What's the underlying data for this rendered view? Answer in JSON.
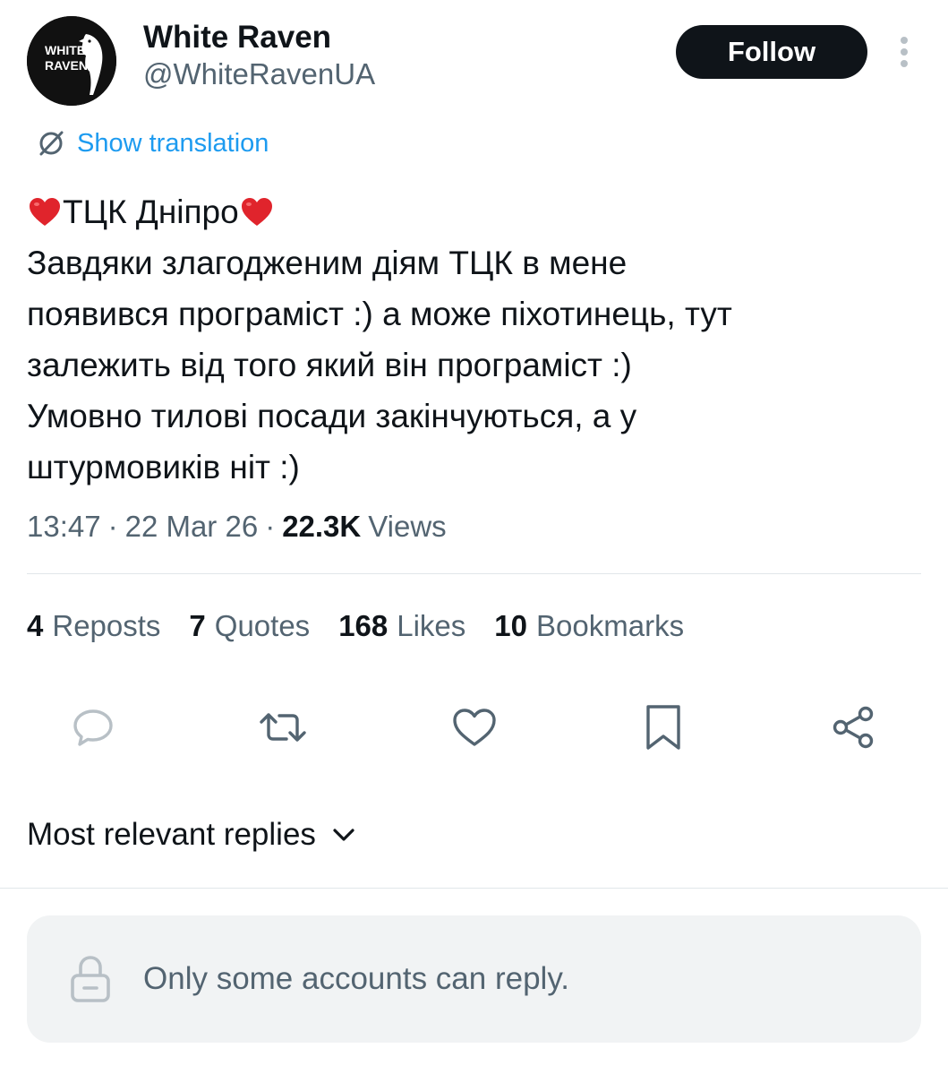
{
  "author": {
    "avatar_lines": [
      "WHITE",
      "RAVEN"
    ],
    "display_name": "White Raven",
    "handle": "@WhiteRavenUA",
    "follow_label": "Follow",
    "more_icon": "more-vertical-icon"
  },
  "translation": {
    "icon": "globe-translate-icon",
    "label": "Show translation"
  },
  "tweet": {
    "heart_emoji": "red-heart-emoji",
    "title_text": "ТЦК Дніпро",
    "lines": [
      "Завдяки злагодженим діям ТЦК в мене",
      "появився програміст :) а може піхотинець, тут",
      "залежить від того який він програміст :)",
      "Умовно тилові посади закінчуються, а у",
      "штурмовиків ніт :)"
    ]
  },
  "meta": {
    "time": "13:47",
    "date": "22 Mar 26",
    "views_count": "22.3K",
    "views_label": "Views",
    "separator": "·"
  },
  "stats": [
    {
      "count": "4",
      "label": "Reposts"
    },
    {
      "count": "7",
      "label": "Quotes"
    },
    {
      "count": "168",
      "label": "Likes"
    },
    {
      "count": "10",
      "label": "Bookmarks"
    }
  ],
  "actions": [
    "reply-icon",
    "repost-icon",
    "like-icon",
    "bookmark-icon",
    "share-icon"
  ],
  "replies": {
    "sort_label": "Most relevant replies",
    "chevron": "chevron-down-icon"
  },
  "reply_restriction": {
    "icon": "lock-icon",
    "message": "Only some accounts can reply."
  },
  "colors": {
    "text_primary": "#0f1419",
    "text_secondary": "#536471",
    "link": "#1d9bf0",
    "follow_bg": "#0f1419",
    "restriction_bg": "#f1f3f4",
    "heart": "#e0242c"
  }
}
